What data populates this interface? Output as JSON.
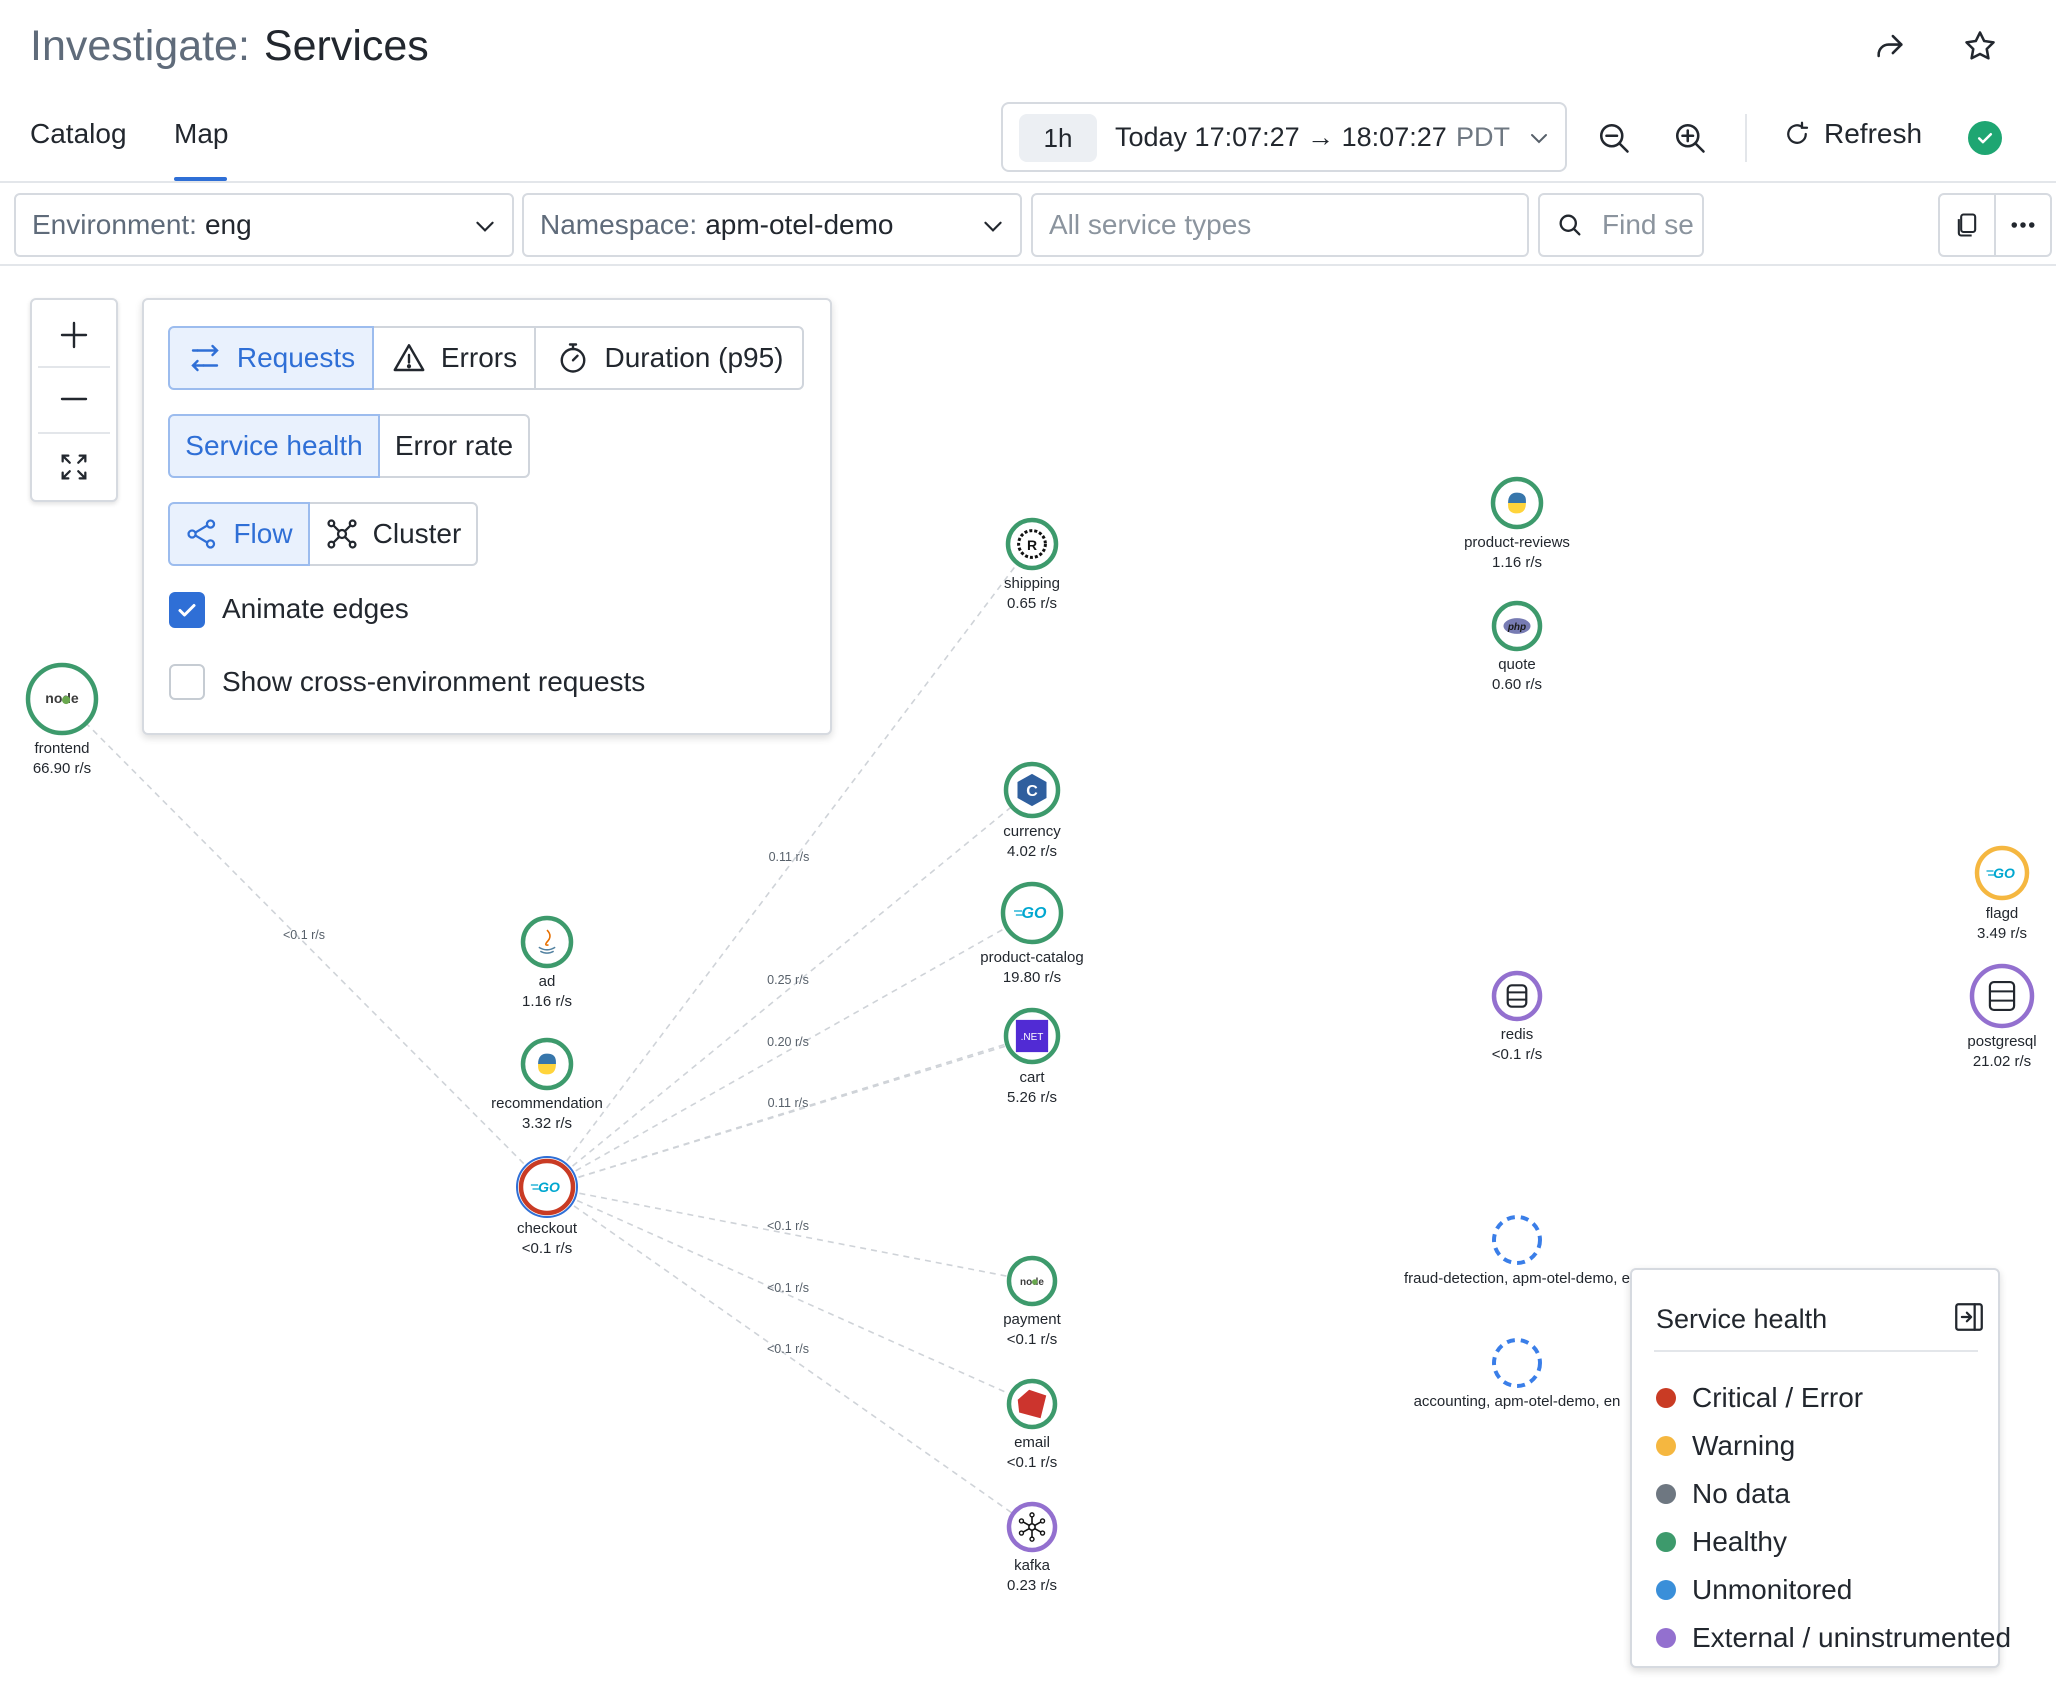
{
  "header": {
    "title_prefix": "Investigate:",
    "title": "Services",
    "share_icon": "share-icon",
    "favorite_icon": "star-icon"
  },
  "tabs": [
    {
      "label": "Catalog",
      "active": false
    },
    {
      "label": "Map",
      "active": true
    }
  ],
  "time_picker": {
    "preset": "1h",
    "range": "Today 17:07:27 → 18:07:27",
    "timezone": "PDT"
  },
  "toolbar": {
    "refresh_label": "Refresh",
    "status": "ok",
    "colors": {
      "accent": "#2f6fd6",
      "ok": "#1ea672"
    }
  },
  "filters": {
    "environment": {
      "label": "Environment:",
      "value": "eng"
    },
    "namespace": {
      "label": "Namespace:",
      "value": "apm-otel-demo"
    },
    "service_types": {
      "placeholder": "All service types"
    },
    "search": {
      "placeholder": "Find se"
    }
  },
  "map_settings": {
    "metric_options": [
      {
        "label": "Requests",
        "icon": "arrows-exchange-icon",
        "active": true
      },
      {
        "label": "Errors",
        "icon": "warning-triangle-icon",
        "active": false
      },
      {
        "label": "Duration (p95)",
        "icon": "stopwatch-icon",
        "active": false
      }
    ],
    "color_options": [
      {
        "label": "Service health",
        "active": true
      },
      {
        "label": "Error rate",
        "active": false
      }
    ],
    "layout_options": [
      {
        "label": "Flow",
        "icon": "flow-icon",
        "active": true
      },
      {
        "label": "Cluster",
        "icon": "cluster-icon",
        "active": false
      }
    ],
    "animate_edges": {
      "label": "Animate edges",
      "checked": true
    },
    "cross_env": {
      "label": "Show cross-environment requests",
      "checked": false
    }
  },
  "services": [
    {
      "id": "frontend",
      "name": "frontend",
      "rate": "66.90 r/s",
      "health": "healthy",
      "icon": "node-icon"
    },
    {
      "id": "ad",
      "name": "ad",
      "rate": "1.16 r/s",
      "health": "healthy",
      "icon": "java-icon"
    },
    {
      "id": "recommendation",
      "name": "recommendation",
      "rate": "3.32 r/s",
      "health": "healthy",
      "icon": "python-icon"
    },
    {
      "id": "checkout",
      "name": "checkout",
      "rate": "<0.1 r/s",
      "health": "critical",
      "icon": "go-icon"
    },
    {
      "id": "shipping",
      "name": "shipping",
      "rate": "0.65 r/s",
      "health": "healthy",
      "icon": "rust-icon"
    },
    {
      "id": "currency",
      "name": "currency",
      "rate": "4.02 r/s",
      "health": "healthy",
      "icon": "cpp-icon"
    },
    {
      "id": "product-catalog",
      "name": "product-catalog",
      "rate": "19.80 r/s",
      "health": "healthy",
      "icon": "go-icon"
    },
    {
      "id": "cart",
      "name": "cart",
      "rate": "5.26 r/s",
      "health": "healthy",
      "icon": "dotnet-icon"
    },
    {
      "id": "payment",
      "name": "payment",
      "rate": "<0.1 r/s",
      "health": "healthy",
      "icon": "node-icon"
    },
    {
      "id": "email",
      "name": "email",
      "rate": "<0.1 r/s",
      "health": "healthy",
      "icon": "ruby-icon"
    },
    {
      "id": "kafka",
      "name": "kafka",
      "rate": "0.23 r/s",
      "health": "external",
      "icon": "kafka-icon"
    },
    {
      "id": "product-reviews",
      "name": "product-reviews",
      "rate": "1.16 r/s",
      "health": "healthy",
      "icon": "python-icon"
    },
    {
      "id": "quote",
      "name": "quote",
      "rate": "0.60 r/s",
      "health": "healthy",
      "icon": "php-icon"
    },
    {
      "id": "redis",
      "name": "redis",
      "rate": "<0.1 r/s",
      "health": "external",
      "icon": "database-icon"
    },
    {
      "id": "fraud-detection",
      "name": "fraud-detection, apm-otel-demo, e",
      "rate": "",
      "health": "unmonitored",
      "icon": ""
    },
    {
      "id": "accounting",
      "name": "accounting, apm-otel-demo, en",
      "rate": "",
      "health": "unmonitored",
      "icon": ""
    },
    {
      "id": "flagd",
      "name": "flagd",
      "rate": "3.49 r/s",
      "health": "warning",
      "icon": "go-icon"
    },
    {
      "id": "postgresql",
      "name": "postgresql",
      "rate": "21.02 r/s",
      "health": "external",
      "icon": "database-icon"
    }
  ],
  "edges": [
    {
      "from": "frontend",
      "to": "checkout",
      "label": "<0.1 r/s"
    },
    {
      "from": "checkout",
      "to": "shipping",
      "label": "0.11 r/s"
    },
    {
      "from": "checkout",
      "to": "currency",
      "label": ""
    },
    {
      "from": "checkout",
      "to": "product-catalog",
      "label": "0.25 r/s"
    },
    {
      "from": "checkout",
      "to": "cart",
      "label": "0.20 r/s"
    },
    {
      "from": "checkout",
      "to": "cart",
      "label": "0.11 r/s"
    },
    {
      "from": "checkout",
      "to": "payment",
      "label": "<0.1 r/s"
    },
    {
      "from": "checkout",
      "to": "email",
      "label": "<0.1 r/s"
    },
    {
      "from": "checkout",
      "to": "kafka",
      "label": "<0.1 r/s"
    }
  ],
  "legend": {
    "title": "Service health",
    "collapse_icon": "collapse-panel-icon",
    "items": [
      {
        "label": "Critical / Error",
        "color": "#c93b24"
      },
      {
        "label": "Warning",
        "color": "#f5b740"
      },
      {
        "label": "No data",
        "color": "#6e7781"
      },
      {
        "label": "Healthy",
        "color": "#3d9a6c"
      },
      {
        "label": "Unmonitored",
        "color": "#3a8fd9"
      },
      {
        "label": "External / uninstrumented",
        "color": "#9370cf"
      }
    ]
  },
  "health_colors": {
    "healthy": "#3d9a6c",
    "critical": "#c93b24",
    "warning": "#f5b740",
    "external": "#9370cf",
    "unmonitored": "#3a7ee8",
    "nodata": "#6e7781"
  }
}
